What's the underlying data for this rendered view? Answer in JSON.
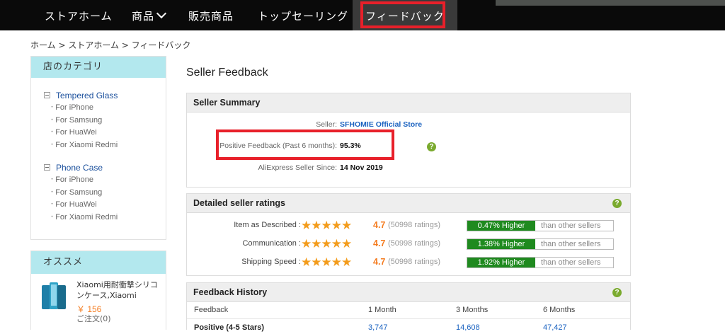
{
  "nav": {
    "items": [
      {
        "label": "ストアホーム"
      },
      {
        "label": "商品"
      },
      {
        "label": "販売商品"
      },
      {
        "label": "トップセーリング"
      },
      {
        "label": "フィードバック"
      }
    ]
  },
  "breadcrumb": [
    "ホーム",
    " > ",
    "ストアホーム",
    " > ",
    "フィードバック"
  ],
  "sidebar": {
    "categories_title": "店のカテゴリ",
    "groups": [
      {
        "title": "Tempered Glass",
        "items": [
          "For iPhone",
          "For Samsung",
          "For HuaWei",
          "For Xiaomi Redmi"
        ]
      },
      {
        "title": "Phone Case",
        "items": [
          "For iPhone",
          "For Samsung",
          "For HuaWei",
          "For Xiaomi Redmi"
        ]
      }
    ],
    "recommend_title": "オススメ",
    "recommend_item": {
      "title": "Xiaomi用耐衝撃シリコンケース,Xiaomi",
      "price": "￥ 156",
      "orders": "ご注文(0)"
    }
  },
  "main": {
    "page_title": "Seller Feedback",
    "summary": {
      "title": "Seller Summary",
      "seller_label": "Seller:",
      "seller_value": "SFHOMIE Official Store",
      "positive_label": "Positive Feedback (Past 6 months):",
      "positive_value": "95.3%",
      "since_label": "AliExpress Seller Since:",
      "since_value": "14 Nov 2019"
    },
    "ratings": {
      "title": "Detailed seller ratings",
      "rows": [
        {
          "label": "Item as Described :",
          "score": "4.7",
          "count": "(50998 ratings)",
          "compare": "0.47% Higher",
          "compare_text": "than other sellers",
          "stars": 5
        },
        {
          "label": "Communication :",
          "score": "4.7",
          "count": "(50998 ratings)",
          "compare": "1.38% Higher",
          "compare_text": "than other sellers",
          "stars": 5
        },
        {
          "label": "Shipping Speed :",
          "score": "4.7",
          "count": "(50998 ratings)",
          "compare": "1.92% Higher",
          "compare_text": "than other sellers",
          "stars": 5
        }
      ]
    },
    "history": {
      "title": "Feedback History",
      "headers": [
        "Feedback",
        "1 Month",
        "3 Months",
        "6 Months"
      ],
      "rows": [
        {
          "label": "Positive (4-5 Stars)",
          "values": [
            "3,747",
            "14,608",
            "47,427"
          ]
        }
      ]
    }
  },
  "colors": {
    "nav_bg": "#0a0a0a",
    "sidebar_head": "#b3e8ee",
    "accent_orange": "#f47c20",
    "higher_green": "#1f8a1f",
    "highlight_red": "#e8202a",
    "link_blue": "#1a62c0"
  },
  "icons": [
    "chevron-down-icon",
    "minus-square-icon",
    "star-icon",
    "help-icon"
  ]
}
